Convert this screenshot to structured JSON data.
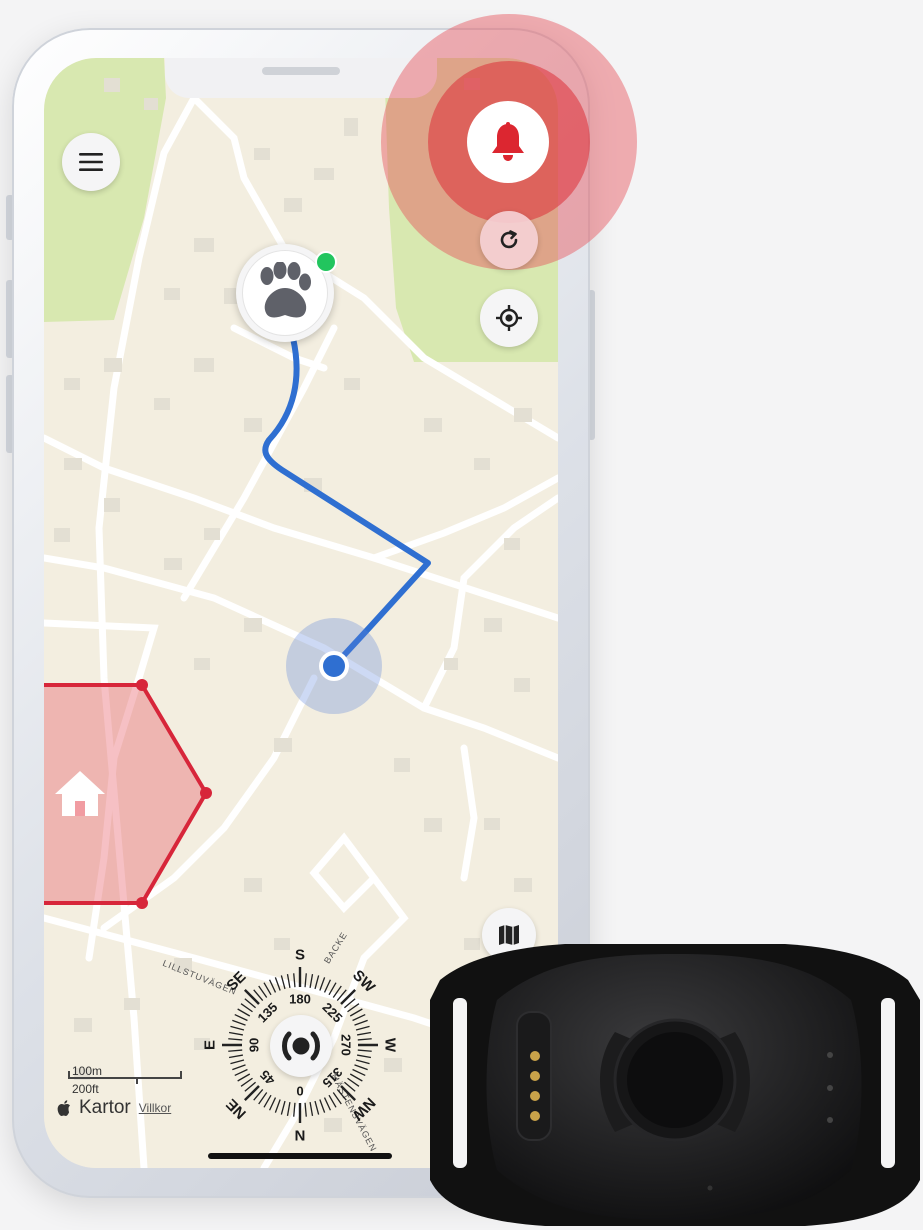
{
  "map": {
    "brand": "Kartor",
    "terms_link": "Villkor",
    "scale_metric": "100m",
    "scale_imperial": "200ft",
    "streets": [
      "LILLSTUVÄGEN",
      "BACKE",
      "MÄSTENSVÄGEN"
    ],
    "compass": {
      "cardinals": [
        "N",
        "NE",
        "E",
        "SE",
        "S",
        "SW",
        "W",
        "NW"
      ],
      "degrees": [
        "0",
        "45",
        "90",
        "135",
        "180",
        "225",
        "270",
        "315"
      ]
    }
  },
  "icons": {
    "menu": "hamburger-menu-icon",
    "alert": "bell-icon",
    "refresh": "refresh-icon",
    "locate": "crosshair-icon",
    "map_type": "map-icon",
    "pet": "paw-icon",
    "home": "home-icon",
    "sound": "broadcast-icon"
  },
  "status": {
    "pet_online": true
  },
  "colors": {
    "route": "#2f6fd1",
    "alert": "#dc2630",
    "geofence": "#d7263a",
    "online": "#22c55e",
    "park": "#d8e8b0",
    "map_background": "#f3eee0"
  }
}
